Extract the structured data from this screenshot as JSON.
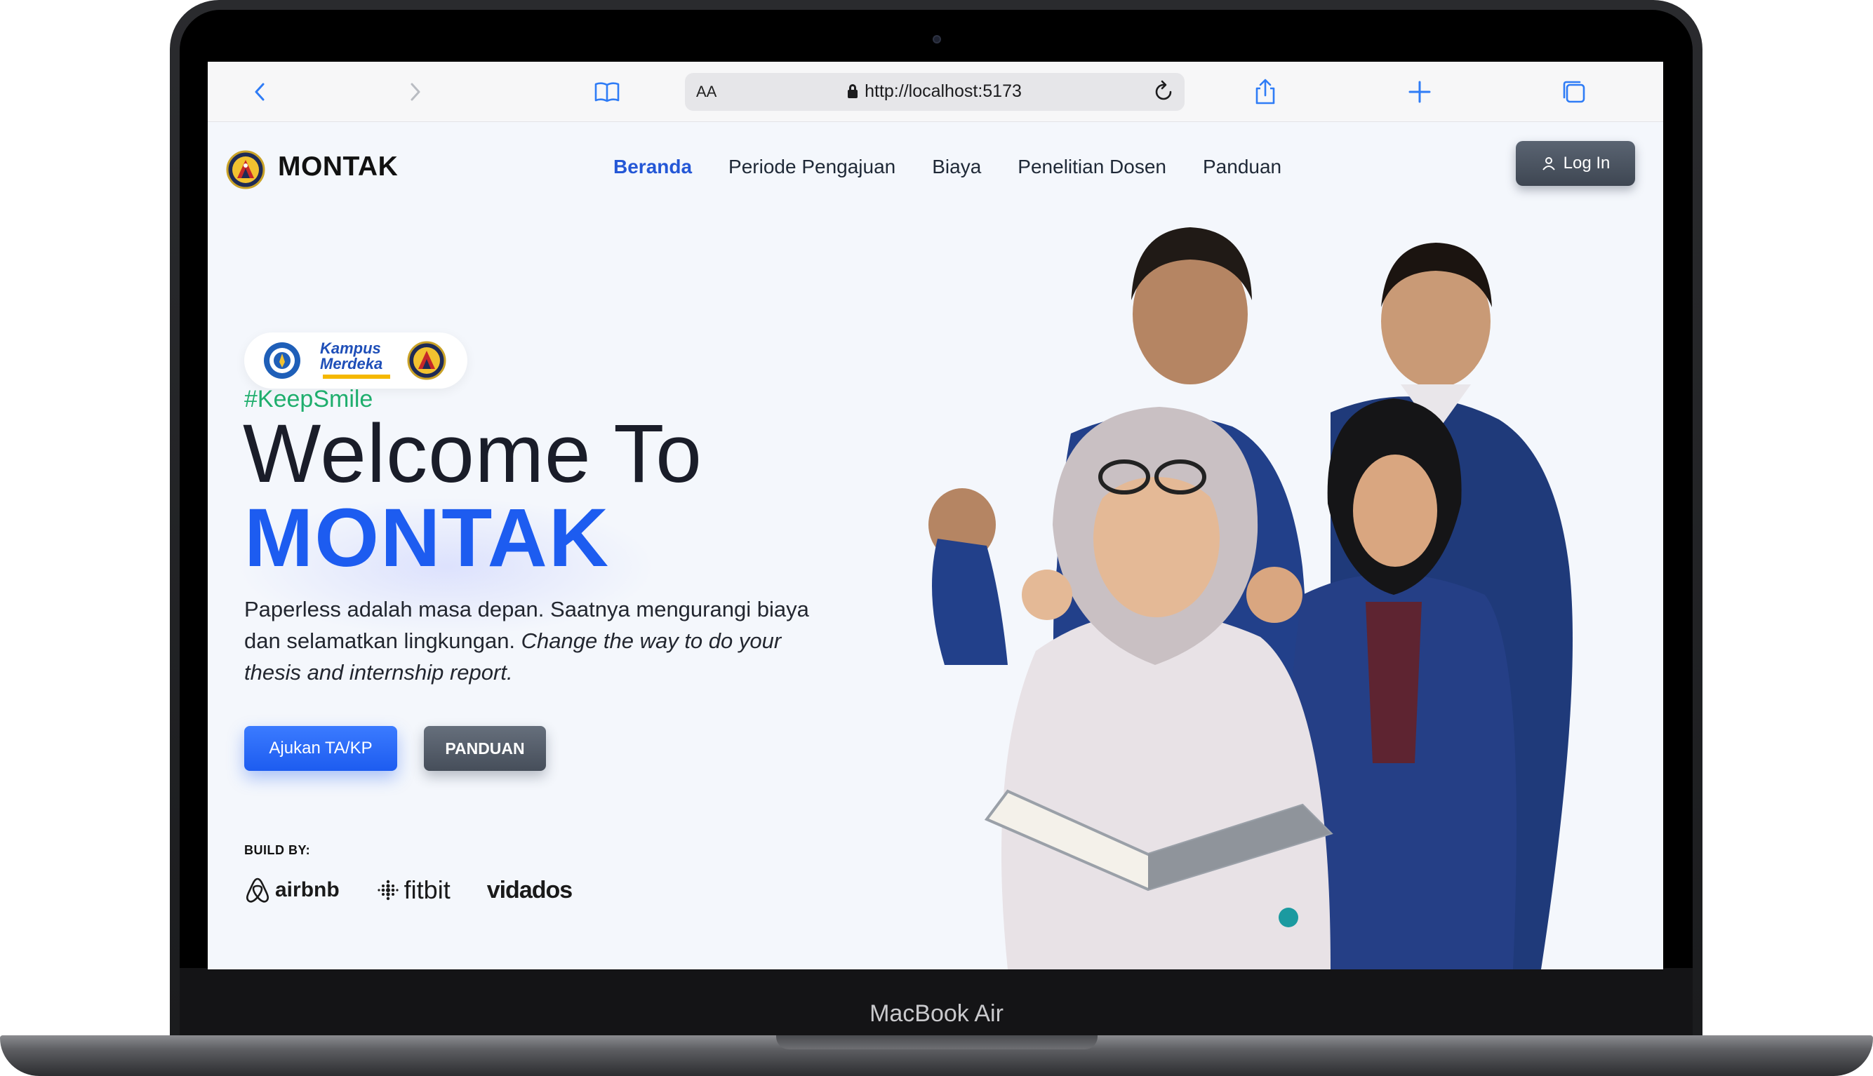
{
  "device": {
    "label": "MacBook Air"
  },
  "browser": {
    "text_size_label": "AA",
    "url": "http://localhost:5173"
  },
  "site": {
    "brand": "MONTAK",
    "nav": [
      {
        "label": "Beranda",
        "active": true
      },
      {
        "label": "Periode Pengajuan",
        "active": false
      },
      {
        "label": "Biaya",
        "active": false
      },
      {
        "label": "Penelitian Dosen",
        "active": false
      },
      {
        "label": "Panduan",
        "active": false
      }
    ],
    "login_label": "Log In"
  },
  "hero": {
    "badge": {
      "line1": "Kampus",
      "line2": "Merdeka"
    },
    "hashtag": "#KeepSmile",
    "title_line1": "Welcome To",
    "title_line2": "MONTAK",
    "description_plain": "Paperless adalah masa depan. Saatnya mengurangi biaya dan selamatkan lingkungan. ",
    "description_italic": "Change the way to do your thesis and internship report.",
    "primary_button": "Ajukan TA/KP",
    "secondary_button": "PANDUAN",
    "build_by_label": "BUILD BY:",
    "partners": [
      {
        "name": "airbnb",
        "icon": "airbnb-icon"
      },
      {
        "name": "fitbit",
        "icon": "fitbit-icon"
      },
      {
        "name": "vidados",
        "icon": "vidados-logo"
      }
    ]
  },
  "colors": {
    "accent": "#1d5cf0",
    "hashtag": "#1fae6d",
    "jacket": "#1f3a7a",
    "background": "#f4f7fc"
  }
}
